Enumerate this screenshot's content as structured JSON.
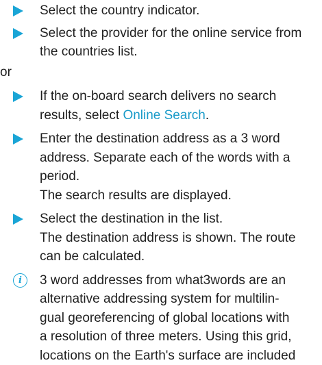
{
  "steps_a": [
    {
      "text": "Select the country indicator."
    },
    {
      "text": "Select the provider for the online service from the countries list."
    }
  ],
  "or_label": "or",
  "step_search": {
    "before": "If the on-board search delivers no search results, select ",
    "link": "Online Search",
    "after": "."
  },
  "step_enter": {
    "text": "Enter the destination address as a 3 word address. Separate each of the words with a period.",
    "result": "The search results are displayed."
  },
  "step_select": {
    "text": "Select the destination in the list.",
    "result": "The destination address is shown. The route can be calculated."
  },
  "note": {
    "lines": [
      "3 word addresses from what3words are an",
      "alternative addressing system for multilin-",
      "gual georeferencing of global locations with",
      "a resolution of three meters. Using this grid,",
      "locations on the Earth's surface are included"
    ]
  },
  "colors": {
    "accent": "#1aa5d6",
    "link": "#1a9bc9",
    "text": "#1f1f1f"
  },
  "icons": {
    "step_marker": "triangle-right-icon",
    "note_marker": "info-icon"
  }
}
